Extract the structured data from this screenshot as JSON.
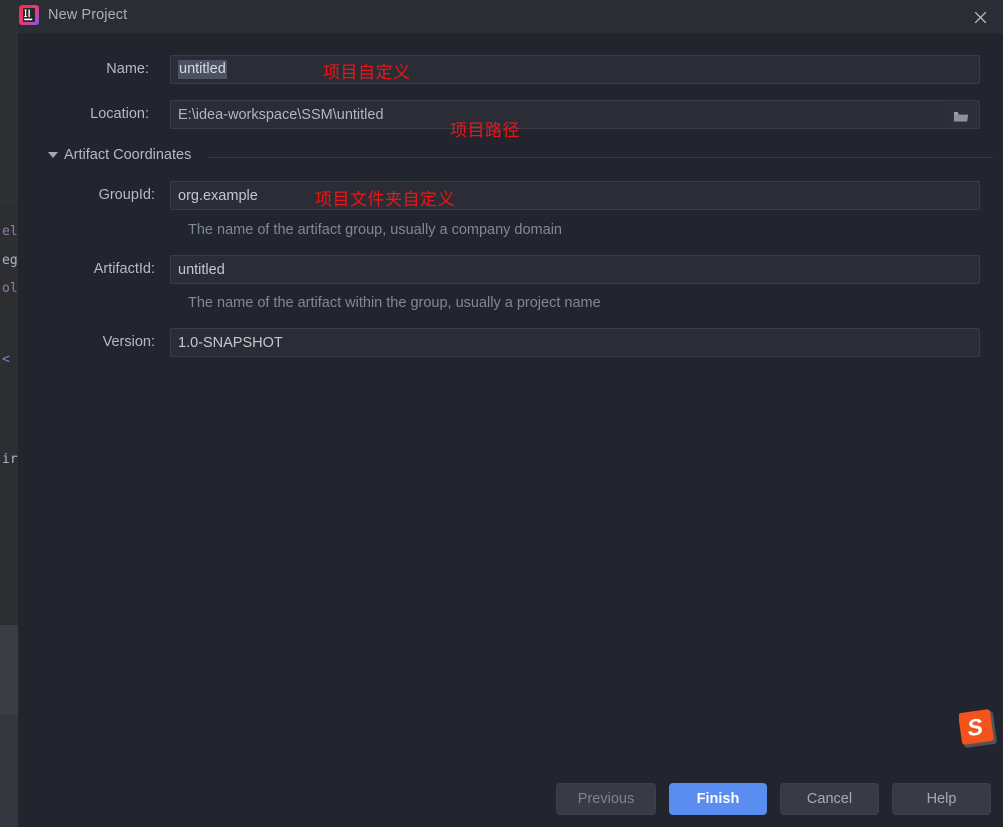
{
  "window": {
    "title": "New Project",
    "logo_icon": "intellij-idea-logo",
    "close_icon": "close-icon"
  },
  "form": {
    "name": {
      "label": "Name:",
      "value": "untitled",
      "selected": true,
      "annotation": "项目自定义"
    },
    "location": {
      "label": "Location:",
      "value": "E:\\idea-workspace\\SSM\\untitled",
      "browse_icon": "folder-icon",
      "annotation": "项目路径"
    },
    "section": {
      "title": "Artifact Coordinates",
      "caret_icon": "chevron-down-icon",
      "expanded": true
    },
    "group_id": {
      "label": "GroupId:",
      "value": "org.example",
      "hint": "The name of the artifact group, usually a company domain",
      "annotation": "项目文件夹自定义"
    },
    "artifact_id": {
      "label": "ArtifactId:",
      "value": "untitled",
      "hint": "The name of the artifact within the group, usually a project name"
    },
    "version": {
      "label": "Version:",
      "value": "1.0-SNAPSHOT"
    }
  },
  "buttons": {
    "previous": "Previous",
    "finish": "Finish",
    "cancel": "Cancel",
    "help": "Help"
  },
  "background_window": {
    "fragments": [
      "el",
      "eg",
      "ol",
      "<",
      "ir"
    ]
  },
  "watermark": {
    "name": "sogou-logo-watermark",
    "letter": "S"
  },
  "colors": {
    "dialog_bg": "#23252e",
    "titlebar_bg": "#2b2d35",
    "field_bg": "#2b2d36",
    "accent_blue": "#5a8df0",
    "annotation_red": "#f01414",
    "watermark_orange": "#f2541b"
  }
}
